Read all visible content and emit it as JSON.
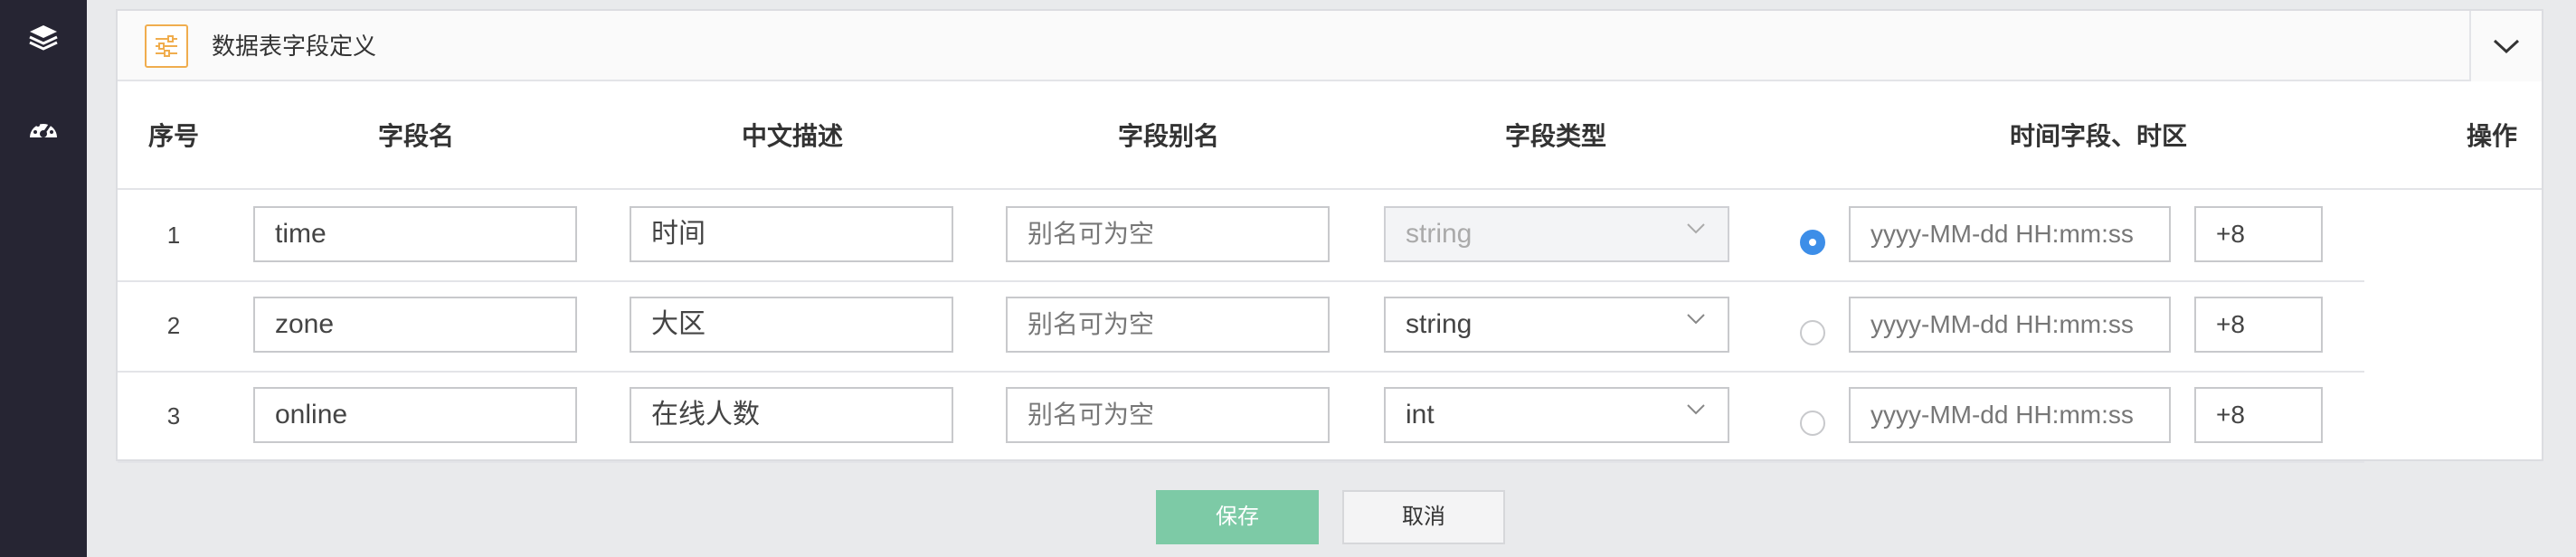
{
  "panel": {
    "title": "数据表字段定义"
  },
  "columns": [
    "序号",
    "字段名",
    "中文描述",
    "字段别名",
    "字段类型",
    "时间字段、时区",
    "操作"
  ],
  "rows": [
    {
      "index": "1",
      "field_name": "time",
      "description": "时间",
      "alias_placeholder": "别名可为空",
      "type": "string",
      "type_disabled": true,
      "time_selected": true,
      "time_format": "yyyy-MM-dd HH:mm:ss",
      "timezone": "+8"
    },
    {
      "index": "2",
      "field_name": "zone",
      "description": "大区",
      "alias_placeholder": "别名可为空",
      "type": "string",
      "type_disabled": false,
      "time_selected": false,
      "time_format": "yyyy-MM-dd HH:mm:ss",
      "timezone": "+8"
    },
    {
      "index": "3",
      "field_name": "online",
      "description": "在线人数",
      "alias_placeholder": "别名可为空",
      "type": "int",
      "type_disabled": false,
      "time_selected": false,
      "time_format": "yyyy-MM-dd HH:mm:ss",
      "timezone": "+8"
    }
  ],
  "actions": {
    "save": "保存",
    "cancel": "取消"
  },
  "colors": {
    "sidebar": "#262533",
    "save": "#7dcaa6",
    "radio_checked": "#3d8ee8",
    "header_icon": "#f0ad4e"
  },
  "icons": {
    "sidebar": [
      "layers-icon",
      "dashboard-icon"
    ],
    "header": "list-settings-icon",
    "collapse": "chevron-down-icon"
  }
}
